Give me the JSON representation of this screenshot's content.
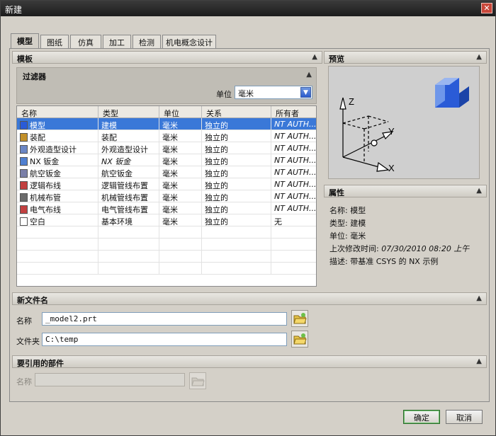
{
  "window": {
    "title": "新建",
    "close_glyph": "✕"
  },
  "tabs": [
    {
      "label": "模型"
    },
    {
      "label": "图纸"
    },
    {
      "label": "仿真"
    },
    {
      "label": "加工"
    },
    {
      "label": "检测"
    },
    {
      "label": "机电概念设计"
    }
  ],
  "templates": {
    "header": "模板",
    "filter": {
      "title": "过滤器",
      "unit_label": "单位",
      "unit_value": "毫米"
    },
    "columns": [
      "名称",
      "类型",
      "单位",
      "关系",
      "所有者"
    ],
    "rows": [
      {
        "icon": "model-icon",
        "name": "模型",
        "type": "建模",
        "unit": "毫米",
        "relation": "独立的",
        "owner": "NT AUTH..."
      },
      {
        "icon": "assembly-icon",
        "name": "装配",
        "type": "装配",
        "unit": "毫米",
        "relation": "独立的",
        "owner": "NT AUTH..."
      },
      {
        "icon": "shape-studio-icon",
        "name": "外观造型设计",
        "type": "外观造型设计",
        "unit": "毫米",
        "relation": "独立的",
        "owner": "NT AUTH..."
      },
      {
        "icon": "sheet-metal-icon",
        "name": "NX 钣金",
        "type": "NX 钣金",
        "unit": "毫米",
        "relation": "独立的",
        "owner": "NT AUTH..."
      },
      {
        "icon": "aero-sheet-metal-icon",
        "name": "航空钣金",
        "type": "航空钣金",
        "unit": "毫米",
        "relation": "独立的",
        "owner": "NT AUTH..."
      },
      {
        "icon": "logic-routing-icon",
        "name": "逻辑布线",
        "type": "逻辑管线布置",
        "unit": "毫米",
        "relation": "独立的",
        "owner": "NT AUTH..."
      },
      {
        "icon": "mech-routing-icon",
        "name": "机械布管",
        "type": "机械管线布置",
        "unit": "毫米",
        "relation": "独立的",
        "owner": "NT AUTH..."
      },
      {
        "icon": "elec-routing-icon",
        "name": "电气布线",
        "type": "电气管线布置",
        "unit": "毫米",
        "relation": "独立的",
        "owner": "NT AUTH..."
      },
      {
        "icon": "blank-icon",
        "name": "空白",
        "type": "基本环境",
        "unit": "毫米",
        "relation": "独立的",
        "owner": "无"
      }
    ],
    "selected_index": 0
  },
  "preview": {
    "header": "预览",
    "axis_x": "X",
    "axis_y": "Y",
    "axis_z": "Z"
  },
  "properties": {
    "header": "属性",
    "items": [
      {
        "key": "名称:",
        "value": "模型"
      },
      {
        "key": "类型:",
        "value": "建模"
      },
      {
        "key": "单位:",
        "value": "毫米"
      },
      {
        "key": "上次修改时间:",
        "value": "07/30/2010 08:20 上午"
      },
      {
        "key": "描述:",
        "value": "带基准 CSYS 的 NX 示例"
      }
    ]
  },
  "new_file": {
    "header": "新文件名",
    "name_label": "名称",
    "name_value": "_model2.prt",
    "folder_label": "文件夹",
    "folder_value": "C:\\temp"
  },
  "referenced": {
    "header": "要引用的部件",
    "name_label": "名称",
    "name_value": ""
  },
  "buttons": {
    "ok": "确定",
    "cancel": "取消"
  },
  "colors": {
    "selection": "#3a78d8",
    "title_bar": "#1c1c1c",
    "dialog_bg": "#d4d0c8"
  }
}
